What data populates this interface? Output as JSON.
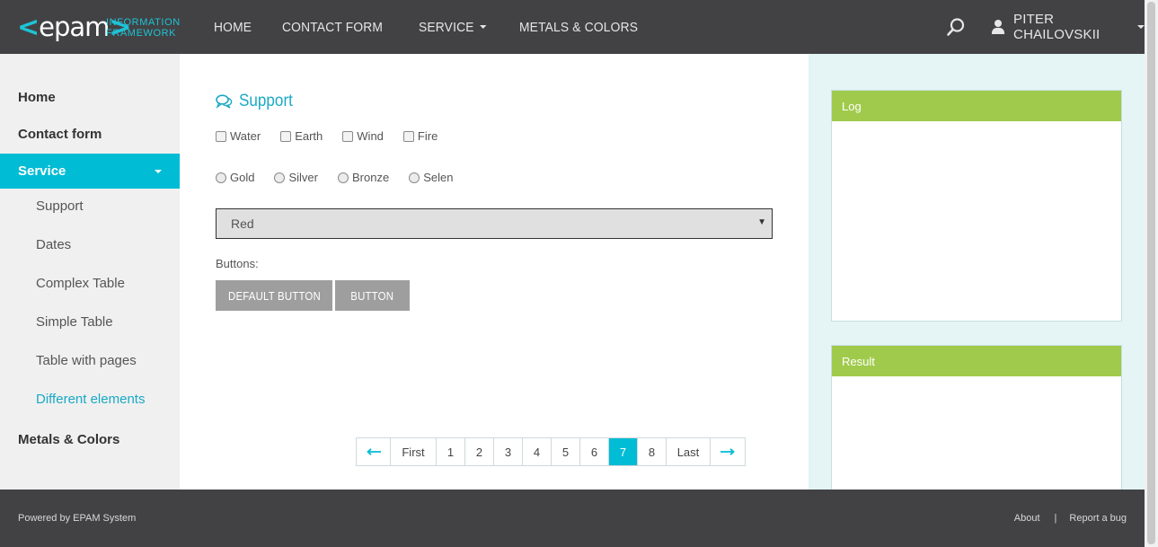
{
  "header": {
    "logo_text": "epam",
    "logo_left": "<",
    "logo_right": ">",
    "logo_sub_1": "INFORMATION",
    "logo_sub_2": "FRAMEWORK",
    "nav": [
      "HOME",
      "CONTACT FORM",
      "SERVICE",
      "METALS & COLORS"
    ],
    "user_name": "PITER CHAILOVSKII"
  },
  "sidebar": {
    "home": "Home",
    "contact_form": "Contact form",
    "service": "Service",
    "sub_items": [
      "Support",
      "Dates",
      "Complex Table",
      "Simple Table",
      "Table with pages",
      "Different elements"
    ],
    "metals_colors": "Metals & Colors"
  },
  "main": {
    "title": "Support",
    "checkboxes": [
      "Water",
      "Earth",
      "Wind",
      "Fire"
    ],
    "radios": [
      "Gold",
      "Silver",
      "Bronze",
      "Selen"
    ],
    "select_value": "Red",
    "buttons_label": "Buttons:",
    "default_button": "DEFAULT BUTTON",
    "button": "BUTTON",
    "pagination": {
      "first": "First",
      "last": "Last",
      "pages": [
        "1",
        "2",
        "3",
        "4",
        "5",
        "6",
        "7",
        "8"
      ],
      "active_page": "7"
    }
  },
  "right": {
    "log_title": "Log",
    "result_title": "Result"
  },
  "footer": {
    "powered": "Powered by EPAM System",
    "about": "About",
    "separator": "|",
    "report": "Report a bug"
  },
  "colors": {
    "header_bg": "#424244",
    "accent": "#00bcd4",
    "panel_header": "#a0ca4b"
  }
}
